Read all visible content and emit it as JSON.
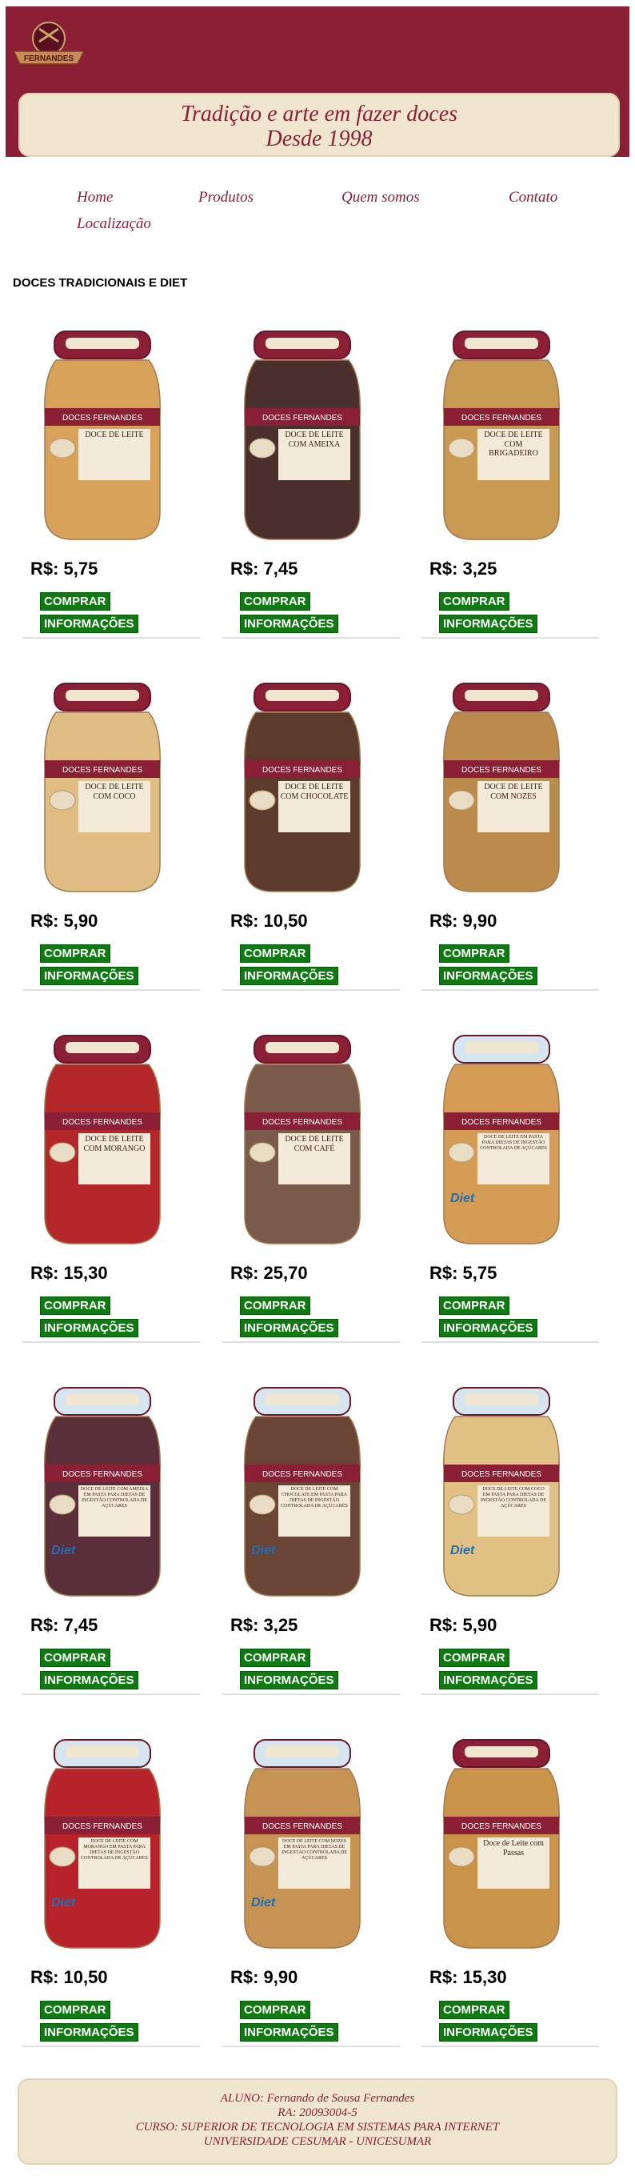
{
  "brand": {
    "logo_text": "FERNANDES"
  },
  "slogan": {
    "line1": "Tradição e arte em fazer doces",
    "line2": "Desde 1998"
  },
  "nav": {
    "home": "Home",
    "products": "Produtos",
    "about": "Quem somos",
    "contact": "Contato",
    "location": "Localização"
  },
  "section_title": "DOCES TRADICIONAIS E DIET",
  "buy_label": "COMPRAR",
  "info_label": "INFORMAÇÕES",
  "products": [
    {
      "price": "R$: 5,75",
      "brand": "DOCES FERNANDES",
      "label": "DOCE DE LEITE",
      "fill": "#d8a25a",
      "lid": "#8a1f35",
      "diet": false
    },
    {
      "price": "R$: 7,45",
      "brand": "DOCES FERNANDES",
      "label": "DOCE DE LEITE COM AMEIXA",
      "fill": "#4a2f2c",
      "lid": "#8a1f35",
      "diet": false
    },
    {
      "price": "R$: 3,25",
      "brand": "DOCES FERNANDES",
      "label": "DOCE DE LEITE COM BRIGADEIRO",
      "fill": "#c99a52",
      "lid": "#8a1f35",
      "diet": false
    },
    {
      "price": "R$: 5,90",
      "brand": "DOCES FERNANDES",
      "label": "DOCE DE LEITE COM COCO",
      "fill": "#e0bd83",
      "lid": "#8a1f35",
      "diet": false
    },
    {
      "price": "R$: 10,50",
      "brand": "DOCES FERNANDES",
      "label": "DOCE DE LEITE COM CHOCOLATE",
      "fill": "#5c3a2c",
      "lid": "#8a1f35",
      "diet": false
    },
    {
      "price": "R$: 9,90",
      "brand": "DOCES FERNANDES",
      "label": "DOCE DE LEITE COM NOZES",
      "fill": "#bd8a4e",
      "lid": "#8a1f35",
      "diet": false
    },
    {
      "price": "R$: 15,30",
      "brand": "DOCES FERNANDES",
      "label": "DOCE DE LEITE COM MORANGO",
      "fill": "#b3262a",
      "lid": "#8a1f35",
      "diet": false
    },
    {
      "price": "R$: 25,70",
      "brand": "DOCES FERNANDES",
      "label": "DOCE DE LEITE COM CAFÉ",
      "fill": "#7a5a4a",
      "lid": "#8a1f35",
      "diet": false
    },
    {
      "price": "R$: 5,75",
      "brand": "DOCES FERNANDES",
      "label": "DOCE DE LEITE EM PASTA PARA DIETAS DE INGESTÃO CONTROLADA DE AÇÚCARES",
      "fill": "#d59c55",
      "lid": "#d7e6ee",
      "diet": true
    },
    {
      "price": "R$: 7,45",
      "brand": "DOCES FERNANDES",
      "label": "DOCE DE LEITE COM AMEIXA EM PASTA PARA DIETAS DE INGESTÃO CONTROLADA DE AÇÚCARES",
      "fill": "#5a2f3a",
      "lid": "#d7e6ee",
      "diet": true
    },
    {
      "price": "R$: 3,25",
      "brand": "DOCES FERNANDES",
      "label": "DOCE DE LEITE COM CHOCOLATE EM PASTA PARA DIETAS DE INGESTÃO CONTROLADA DE AÇÚCARES",
      "fill": "#6a4536",
      "lid": "#d7e6ee",
      "diet": true
    },
    {
      "price": "R$: 5,90",
      "brand": "DOCES FERNANDES",
      "label": "DOCE DE LEITE COM COCO EM PASTA PARA DIETAS DE INGESTÃO CONTROLADA DE AÇÚCARES",
      "fill": "#e2c185",
      "lid": "#d7e6ee",
      "diet": true
    },
    {
      "price": "R$: 10,50",
      "brand": "DOCES FERNANDES",
      "label": "DOCE DE LEITE COM MORANGO EM PASTA PARA DIETAS DE INGESTÃO CONTROLADA DE AÇÚCARES",
      "fill": "#b8232b",
      "lid": "#d7e6ee",
      "diet": true
    },
    {
      "price": "R$: 9,90",
      "brand": "DOCES FERNANDES",
      "label": "DOCE DE LEITE COM NOZES EM PASTA PARA DIETAS DE INGESTÃO CONTROLADA DE AÇÚCARES",
      "fill": "#c79352",
      "lid": "#d7e6ee",
      "diet": true
    },
    {
      "price": "R$: 15,30",
      "brand": "DOCES FERNANDES",
      "label": "Doce de Leite com Passas",
      "fill": "#c9944a",
      "lid": "#8a1f35",
      "diet": false
    }
  ],
  "footer": {
    "line1": "ALUNO: Fernando de Sousa Fernandes",
    "line2": "RA: 20093004-5",
    "line3": "CURSO: SUPERIOR DE TECNOLOGIA EM SISTEMAS PARA INTERNET",
    "line4": "UNIVERSIDADE CESUMAR - UNICESUMAR"
  },
  "colors": {
    "brand": "#8a1f35",
    "cream": "#f0e5cf",
    "button_green": "#0f7a12"
  }
}
